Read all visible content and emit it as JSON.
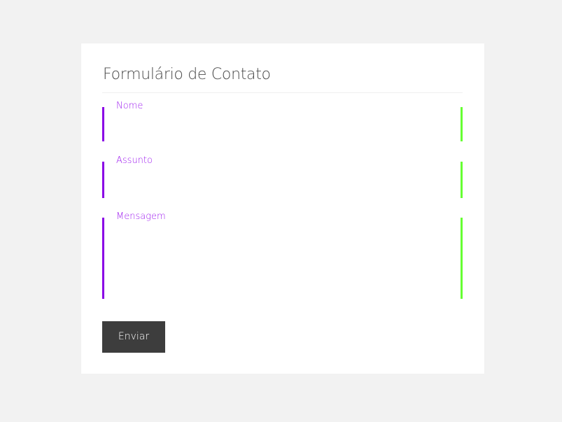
{
  "form": {
    "title": "Formulário de Contato",
    "fields": [
      {
        "label": "Nome",
        "value": "",
        "placeholder": ""
      },
      {
        "label": "Assunto",
        "value": "",
        "placeholder": ""
      },
      {
        "label": "Mensagem",
        "value": "",
        "placeholder": ""
      }
    ],
    "submit_label": "Enviar"
  },
  "colors": {
    "page_background": "#f2f2f2",
    "card_background": "#ffffff",
    "label_color": "#a020f0",
    "button_background": "#3d3d3d",
    "border_gradient": [
      "#8a2be2",
      "#ff00ff",
      "#ff0000",
      "#ffff00",
      "#7fff00",
      "#00ffff",
      "#0000ff"
    ]
  }
}
